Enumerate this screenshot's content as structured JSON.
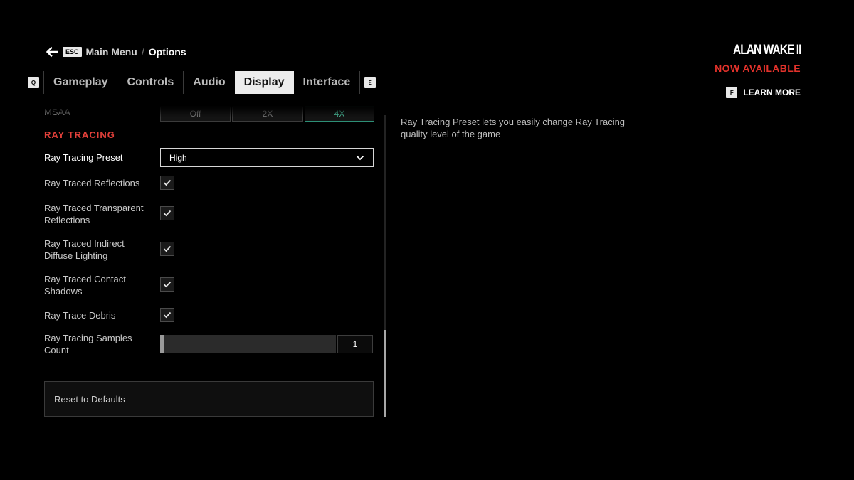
{
  "breadcrumb": {
    "back_key": "ESC",
    "parent": "Main Menu",
    "separator": "/",
    "current": "Options"
  },
  "tabs": {
    "prev_key": "Q",
    "next_key": "E",
    "items": [
      {
        "label": "Gameplay",
        "active": false
      },
      {
        "label": "Controls",
        "active": false
      },
      {
        "label": "Audio",
        "active": false
      },
      {
        "label": "Display",
        "active": true
      },
      {
        "label": "Interface",
        "active": false
      }
    ]
  },
  "promo": {
    "logo_text": "ALAN WAKE II",
    "availability": "NOW AVAILABLE",
    "learn_more_key": "F",
    "learn_more_label": "LEARN MORE"
  },
  "settings": {
    "msaa": {
      "label": "MSAA",
      "options": [
        "Off",
        "2X",
        "4X"
      ],
      "selected": "4X"
    },
    "section_title": "RAY TRACING",
    "preset": {
      "label": "Ray Tracing Preset",
      "value": "High"
    },
    "toggles": [
      {
        "label": "Ray Traced Reflections",
        "checked": true
      },
      {
        "label": "Ray Traced Transparent Reflections",
        "checked": true
      },
      {
        "label": "Ray Traced Indirect Diffuse Lighting",
        "checked": true
      },
      {
        "label": "Ray Traced Contact Shadows",
        "checked": true
      },
      {
        "label": "Ray Trace Debris",
        "checked": true
      }
    ],
    "samples": {
      "label": "Ray Tracing Samples Count",
      "value": "1"
    },
    "reset_label": "Reset to Defaults"
  },
  "description": "Ray Tracing Preset lets you easily change Ray Tracing quality level of the game",
  "colors": {
    "accent_red": "#e3322b",
    "selected_teal": "#4fc6a3",
    "active_tab_bg": "#ececec"
  }
}
